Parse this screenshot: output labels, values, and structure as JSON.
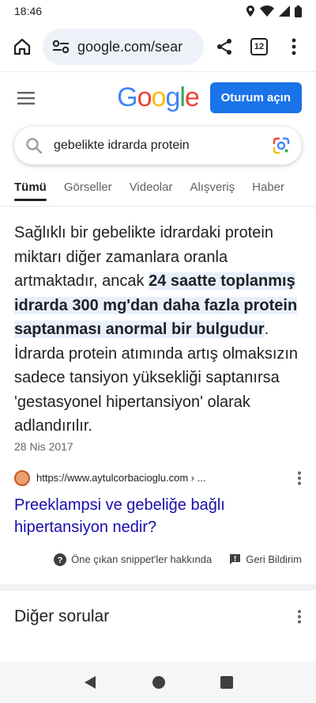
{
  "status_bar": {
    "time": "18:46"
  },
  "browser": {
    "url": "google.com/sear",
    "tab_count": "12"
  },
  "header": {
    "logo": "Google",
    "signin_label": "Oturum açın"
  },
  "search": {
    "query": "gebelikte idrarda protein"
  },
  "tabs": [
    {
      "label": "Tümü",
      "active": true
    },
    {
      "label": "Görseller"
    },
    {
      "label": "Videolar"
    },
    {
      "label": "Alışveriş"
    },
    {
      "label": "Haber"
    }
  ],
  "snippet": {
    "text_before": "Sağlıklı bir gebelikte idrardaki protein miktarı diğer zamanlara oranla artmaktadır, ancak ",
    "text_highlight": "24 saatte toplanmış idrarda 300 mg'dan daha fazla protein saptanması anormal bir bulgudur",
    "text_after": ". İdrarda protein atımında artış olmaksızın sadece tansiyon yüksekliği saptanırsa 'gestasyonel hipertansiyon' olarak adlandırılır.",
    "date": "28 Nis 2017",
    "source_url": "https://www.aytulcorbacioglu.com › ...",
    "title": "Preeklampsi ve gebeliğe bağlı hipertansiyon nedir?"
  },
  "footer": {
    "about_label": "Öne çıkan snippet'ler hakkında",
    "feedback_label": "Geri Bildirim"
  },
  "more_questions": {
    "title": "Diğer sorular"
  },
  "colors": {
    "accent": "#1a73e8",
    "link": "#1a0dab",
    "highlight": "#e8f0fe"
  }
}
